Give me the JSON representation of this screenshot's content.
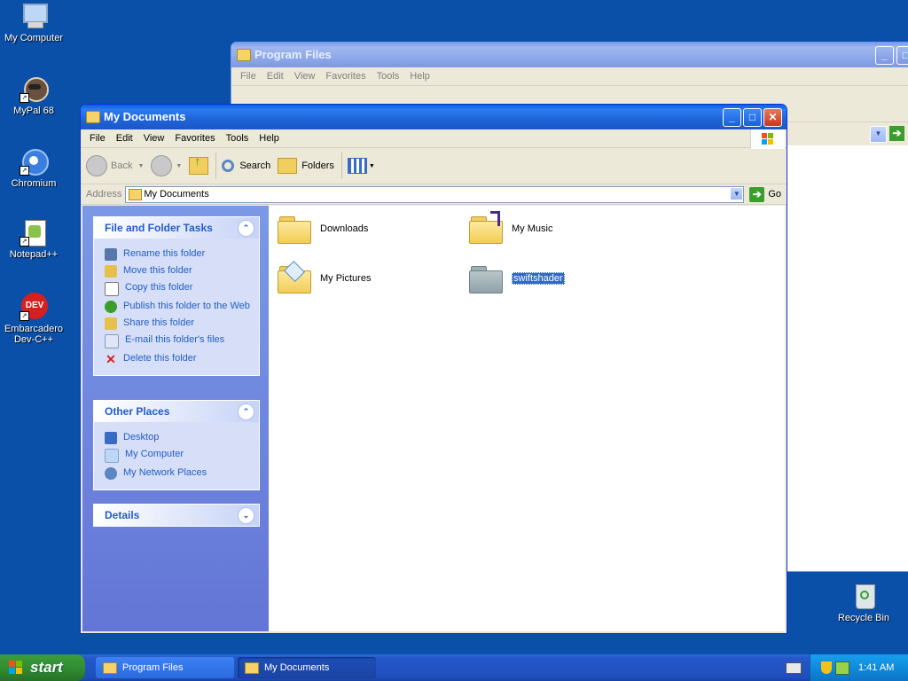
{
  "desktop": {
    "icons": [
      {
        "label": "My Computer"
      },
      {
        "label": "MyPal 68"
      },
      {
        "label": "Chromium"
      },
      {
        "label": "Notepad++"
      },
      {
        "label": "Embarcadero Dev-C++"
      },
      {
        "label": "Recycle Bin"
      }
    ]
  },
  "bg_window": {
    "title": "Program Files",
    "menu": [
      "File",
      "Edit",
      "View",
      "Favorites",
      "Tools",
      "Help"
    ]
  },
  "window": {
    "title": "My Documents",
    "menu": [
      "File",
      "Edit",
      "View",
      "Favorites",
      "Tools",
      "Help"
    ],
    "toolbar": {
      "back": "Back",
      "search": "Search",
      "folders": "Folders"
    },
    "address": {
      "label": "Address",
      "value": "My Documents",
      "go": "Go"
    },
    "tasks": {
      "title": "File and Folder Tasks",
      "items": [
        "Rename this folder",
        "Move this folder",
        "Copy this folder",
        "Publish this folder to the Web",
        "Share this folder",
        "E-mail this folder's files",
        "Delete this folder"
      ]
    },
    "places": {
      "title": "Other Places",
      "items": [
        "Desktop",
        "My Computer",
        "My Network Places"
      ]
    },
    "details": {
      "title": "Details"
    },
    "items": [
      "Downloads",
      "My Music",
      "My Pictures",
      "swiftshader"
    ]
  },
  "taskbar": {
    "start": "start",
    "buttons": [
      "Program Files",
      "My Documents"
    ],
    "clock": "1:41 AM"
  }
}
